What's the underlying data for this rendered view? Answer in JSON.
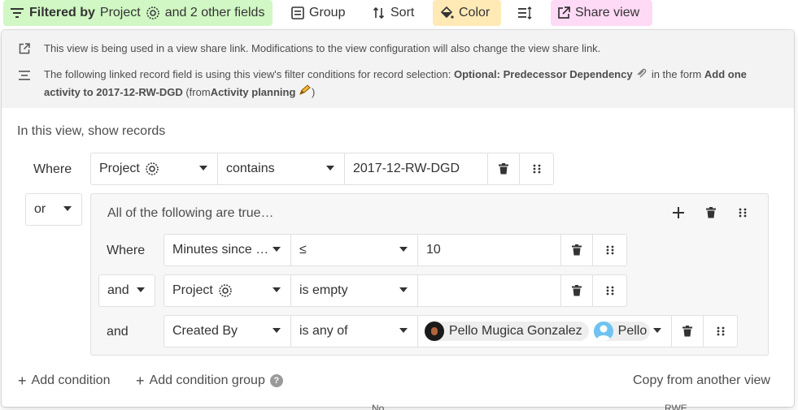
{
  "toolbar": {
    "filter_strong": "Filtered by",
    "filter_field": "Project",
    "filter_rest": "and 2 other fields",
    "group": "Group",
    "sort": "Sort",
    "color": "Color",
    "share": "Share view",
    "colors": {
      "filter_bg": "#d1f7c4",
      "color_bg": "#ffeab6",
      "share_bg": "#ffdaf6"
    }
  },
  "notices": {
    "share_link": "This view is being used in a view share link. Modifications to the view configuration will also change the view share link.",
    "linked_prefix": "The following linked record field is using this view's filter conditions for record selection:",
    "linked_field": "Optional: Predecessor Dependency",
    "linked_mid": "in the form",
    "form_name": "Add one activity to 2017-12-RW-DGD",
    "from_open": "(from",
    "from_table": "Activity planning",
    "from_close": ")"
  },
  "intro": "In this view, show records",
  "top_condition": {
    "label": "Where",
    "field": "Project",
    "operator": "contains",
    "value": "2017-12-RW-DGD"
  },
  "group": {
    "conjunction": "or",
    "title": "All of the following are true…",
    "conditions": [
      {
        "label": "Where",
        "field": "Minutes since …",
        "operator": "≤",
        "value": "10"
      },
      {
        "label": "and",
        "field": "Project",
        "operator": "is empty",
        "value": ""
      },
      {
        "label": "and",
        "field": "Created By",
        "operator": "is any of",
        "users": [
          "Pello Mugica Gonzalez",
          "Pello"
        ]
      }
    ]
  },
  "footer": {
    "add_condition": "Add condition",
    "add_group": "Add condition group",
    "help": "?",
    "copy": "Copy from another view"
  },
  "background": {
    "peek_left": "No",
    "peek_right": "RWE"
  }
}
